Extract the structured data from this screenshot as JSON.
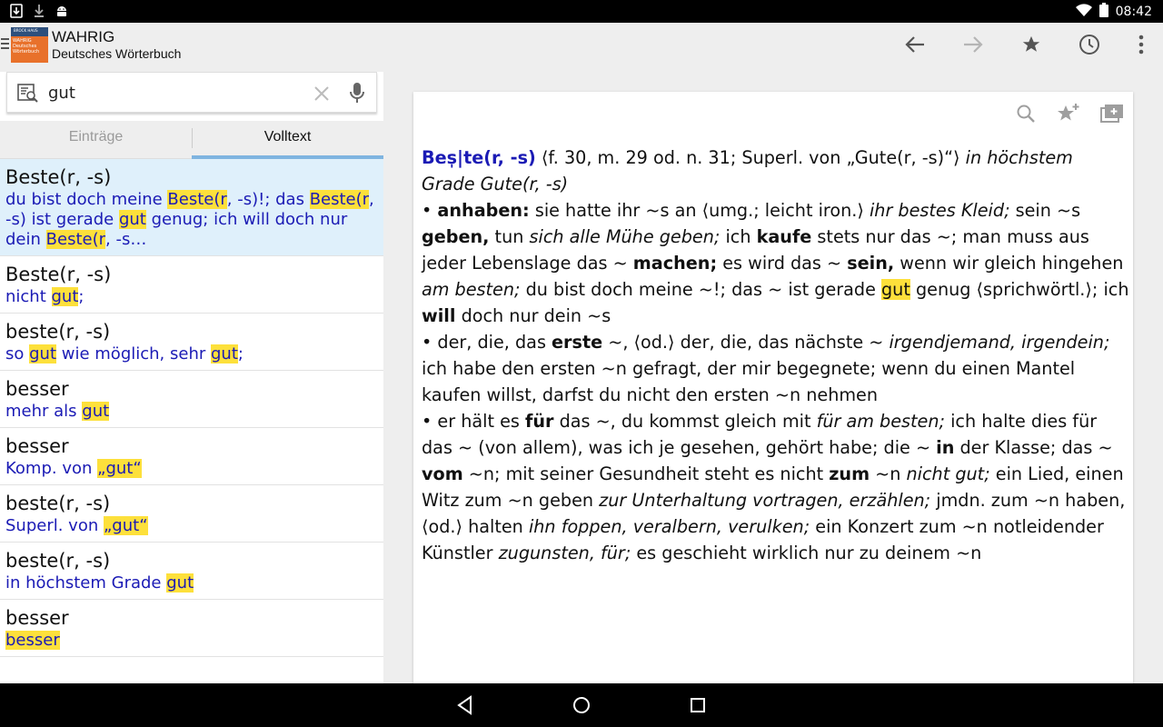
{
  "status_bar": {
    "time": "08:42",
    "left_icons": [
      "download-icon",
      "download-done-icon",
      "android-icon"
    ],
    "right_icons": [
      "wifi-icon",
      "battery-icon"
    ]
  },
  "app_bar": {
    "title": "WAHRIG",
    "subtitle": "Deutsches Wörterbuch",
    "logo": {
      "brand": "BROCK HAUS",
      "text": "WAHRIG Deutsches Wörterbuch"
    },
    "actions": [
      "back-arrow-icon",
      "forward-arrow-icon",
      "star-icon",
      "history-icon",
      "overflow-menu-icon"
    ]
  },
  "search": {
    "value": "gut",
    "placeholder": ""
  },
  "tabs": [
    {
      "label": "Einträge",
      "active": false
    },
    {
      "label": "Volltext",
      "active": true
    }
  ],
  "results": [
    {
      "head": "Beste(r, -s)",
      "selected": true,
      "snippet": [
        {
          "t": "du bist doch meine "
        },
        {
          "t": "Beste(r",
          "h": true
        },
        {
          "t": ", -s)!; das "
        },
        {
          "t": "Beste(r",
          "h": true
        },
        {
          "t": ", -s) ist gerade "
        },
        {
          "t": "gut",
          "h": true
        },
        {
          "t": " genug; ich will doch nur dein "
        },
        {
          "t": "Beste(r",
          "h": true
        },
        {
          "t": ", -s…"
        }
      ]
    },
    {
      "head": "Beste(r, -s)",
      "snippet": [
        {
          "t": "nicht "
        },
        {
          "t": "gut",
          "h": true
        },
        {
          "t": ";"
        }
      ]
    },
    {
      "head": "beste(r, -s)",
      "snippet": [
        {
          "t": "so "
        },
        {
          "t": "gut",
          "h": true
        },
        {
          "t": " wie möglich, sehr "
        },
        {
          "t": "gut",
          "h": true
        },
        {
          "t": ";"
        }
      ]
    },
    {
      "head": "besser",
      "snippet": [
        {
          "t": "mehr als "
        },
        {
          "t": "gut",
          "h": true
        }
      ]
    },
    {
      "head": "besser",
      "snippet": [
        {
          "t": "Komp. von "
        },
        {
          "t": "„gut“",
          "h": true
        }
      ]
    },
    {
      "head": "beste(r, -s)",
      "snippet": [
        {
          "t": "Superl. von "
        },
        {
          "t": "„gut“",
          "h": true
        }
      ]
    },
    {
      "head": "beste(r, -s)",
      "snippet": [
        {
          "t": "in höchstem Grade "
        },
        {
          "t": "gut",
          "h": true
        }
      ]
    },
    {
      "head": "besser",
      "snippet": [
        {
          "t": "besser",
          "h": true
        }
      ]
    }
  ],
  "card_actions": [
    "search-icon",
    "add-favorite-icon",
    "new-window-icon"
  ],
  "entry": {
    "lemma": "Bes̩|te(r, -s)",
    "segments": [
      {
        "t": " ⟨f. 30, m. 29 od. n. 31; Superl. von „Gute(r, -s)“⟩ "
      },
      {
        "t": "in höchstem Grade Gute(r, -s)",
        "s": "i"
      },
      {
        "t": "\n• "
      },
      {
        "t": "anhaben:",
        "s": "b"
      },
      {
        "t": " sie hatte ihr ~s an ⟨umg.; leicht iron.⟩ "
      },
      {
        "t": "ihr bestes Kleid;",
        "s": "i"
      },
      {
        "t": " sein ~s "
      },
      {
        "t": "geben,",
        "s": "b"
      },
      {
        "t": " tun "
      },
      {
        "t": "sich alle Mühe geben;",
        "s": "i"
      },
      {
        "t": " ich "
      },
      {
        "t": "kaufe",
        "s": "b"
      },
      {
        "t": " stets nur das ~; man muss aus jeder Lebenslage das ~ "
      },
      {
        "t": "machen;",
        "s": "b"
      },
      {
        "t": " es wird das ~ "
      },
      {
        "t": "sein,",
        "s": "b"
      },
      {
        "t": " wenn wir gleich hingehen "
      },
      {
        "t": "am besten;",
        "s": "i"
      },
      {
        "t": " du bist doch meine ~!; das ~ ist gerade "
      },
      {
        "t": "gut",
        "s": "h"
      },
      {
        "t": " genug ⟨sprichwörtl.⟩; ich "
      },
      {
        "t": "will",
        "s": "b"
      },
      {
        "t": " doch nur dein ~s"
      },
      {
        "t": "\n• der, die, das "
      },
      {
        "t": "erste",
        "s": "b"
      },
      {
        "t": " ~, ⟨od.⟩ der, die, das nächste ~ "
      },
      {
        "t": "irgendjemand, irgendein;",
        "s": "i"
      },
      {
        "t": " ich habe den ersten ~n gefragt, der mir begegnete; wenn du einen Mantel kaufen willst, darfst du nicht den ersten ~n nehmen"
      },
      {
        "t": "\n• er hält es "
      },
      {
        "t": "für",
        "s": "b"
      },
      {
        "t": " das ~, du kommst gleich mit "
      },
      {
        "t": "für am besten;",
        "s": "i"
      },
      {
        "t": " ich halte dies für das ~ (von allem), was ich je gesehen, gehört habe; die ~ "
      },
      {
        "t": "in",
        "s": "b"
      },
      {
        "t": " der Klasse; das ~ "
      },
      {
        "t": "vom",
        "s": "b"
      },
      {
        "t": " ~n; mit seiner Gesundheit steht es nicht "
      },
      {
        "t": "zum",
        "s": "b"
      },
      {
        "t": " ~n "
      },
      {
        "t": "nicht gut;",
        "s": "i"
      },
      {
        "t": " ein Lied, einen Witz zum ~n geben "
      },
      {
        "t": "zur Unterhaltung vortragen, erzählen;",
        "s": "i"
      },
      {
        "t": " jmdn. zum ~n haben, ⟨od.⟩ halten "
      },
      {
        "t": "ihn foppen, veralbern, verulken;",
        "s": "i"
      },
      {
        "t": " ein Konzert zum ~n notleidender Künstler "
      },
      {
        "t": "zugunsten, für;",
        "s": "i"
      },
      {
        "t": " es geschieht wirklich nur zu deinem ~n"
      }
    ]
  },
  "nav_bar": [
    "back-triangle-icon",
    "home-circle-icon",
    "recents-square-icon"
  ]
}
